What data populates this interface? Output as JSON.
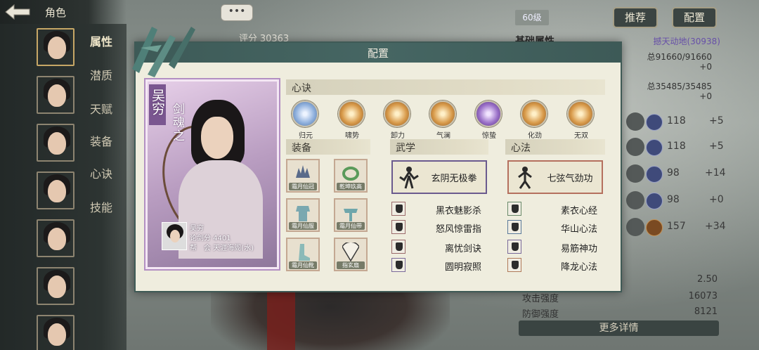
{
  "nav": {
    "title": "角色",
    "tabs": [
      "属性",
      "潜质",
      "天赋",
      "装备",
      "心诀",
      "技能"
    ]
  },
  "header": {
    "chat": "•••",
    "score_label": "评分",
    "score": "30363",
    "level": "60级",
    "recommend": "推荐",
    "config": "配置"
  },
  "stats": {
    "title": "基础属性",
    "link": "撼天动地(30938)",
    "hp_total": "总91660/91660",
    "hp_delta": "+0",
    "mp_total": "总35485/35485",
    "mp_delta": "+0",
    "rows": [
      {
        "value": "118",
        "delta": "+5"
      },
      {
        "value": "118",
        "delta": "+5"
      },
      {
        "value": "98",
        "delta": "+14"
      },
      {
        "value": "98",
        "delta": "+0"
      },
      {
        "value": "157",
        "delta": "+34"
      }
    ],
    "bottom": [
      {
        "label": "",
        "value": "2.50"
      },
      {
        "label": "攻击强度",
        "value": "16073"
      },
      {
        "label": "防御强度",
        "value": "8121"
      }
    ],
    "more": "更多详情"
  },
  "modal": {
    "title": "配置",
    "card": {
      "name": "吴穷",
      "title": "剑魂之",
      "info_name": "吴穷",
      "info_score": "论剑分 4401",
      "info_guild": "帮　会 天涯海阁(水)"
    },
    "heart_section": "心诀",
    "hearts": [
      {
        "label": "归元",
        "color": "#8fb0dd"
      },
      {
        "label": "啸势",
        "color": "#d89a4a"
      },
      {
        "label": "卸力",
        "color": "#d89a4a"
      },
      {
        "label": "气澜",
        "color": "#d89a4a"
      },
      {
        "label": "惊蛰",
        "color": "#9a70c8"
      },
      {
        "label": "化劲",
        "color": "#d89a4a"
      },
      {
        "label": "无双",
        "color": "#d89a4a"
      }
    ],
    "equip_section": "装备",
    "equips": [
      {
        "tag": "霜月仙冠"
      },
      {
        "tag": "乾坤玖高"
      },
      {
        "tag": "霜月仙服"
      },
      {
        "tag": "霜月仙带"
      },
      {
        "tag": "霜月仙靴"
      },
      {
        "tag": "指玄扇"
      }
    ],
    "wuxue_section": "武学",
    "wuxue_main": "玄阴无极拳",
    "wuxue_list": [
      "黑衣魅影杀",
      "怒风惊雷指",
      "离忧剑诀",
      "圆明寂照"
    ],
    "xinfa_section": "心法",
    "xinfa_main": "七弦气劲功",
    "xinfa_list": [
      "素衣心经",
      "华山心法",
      "易筋神功",
      "降龙心法"
    ]
  }
}
